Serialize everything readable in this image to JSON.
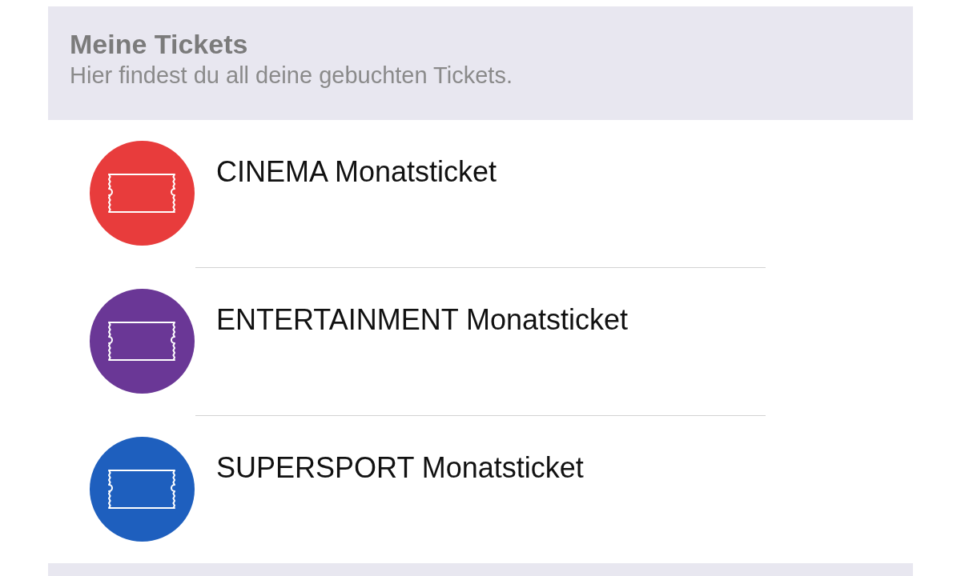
{
  "header": {
    "title": "Meine Tickets",
    "subtitle": "Hier findest du all deine gebuchten Tickets."
  },
  "tickets": [
    {
      "name": "CINEMA Monatsticket",
      "color": "#e83c3c"
    },
    {
      "name": "ENTERTAINMENT Monatsticket",
      "color": "#6a3796"
    },
    {
      "name": "SUPERSPORT Monatsticket",
      "color": "#1e5fbe"
    }
  ]
}
